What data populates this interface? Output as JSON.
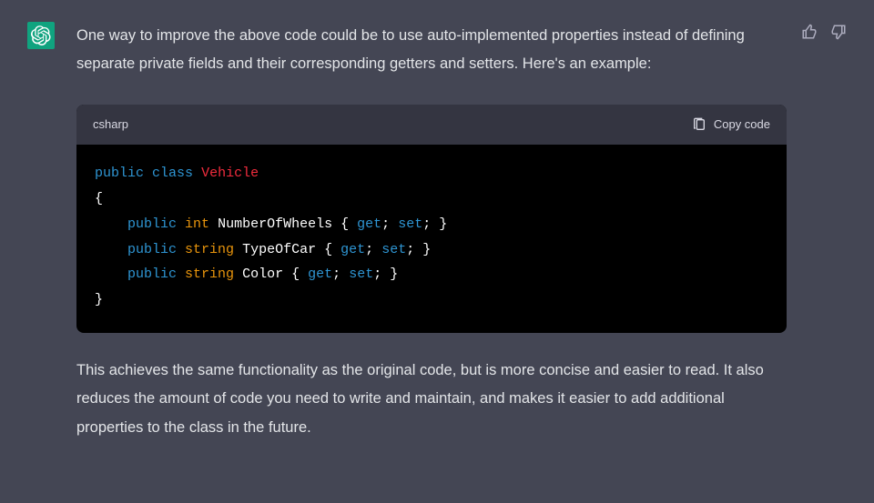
{
  "avatar": {
    "bg": "#10a37f"
  },
  "message": {
    "intro": "One way to improve the above code could be to use auto-implemented properties instead of defining separate private fields and their corresponding getters and setters. Here's an example:",
    "outro": "This achieves the same functionality as the original code, but is more concise and easier to read. It also reduces the amount of code you need to write and maintain, and makes it easier to add additional properties to the class in the future."
  },
  "codeblock": {
    "language": "csharp",
    "copy_label": "Copy code",
    "tokens": [
      [
        [
          "kw",
          "public"
        ],
        [
          "sp",
          " "
        ],
        [
          "kw",
          "class"
        ],
        [
          "sp",
          " "
        ],
        [
          "cls",
          "Vehicle"
        ]
      ],
      [
        [
          "punc",
          "{"
        ]
      ],
      [
        [
          "sp",
          "    "
        ],
        [
          "kw",
          "public"
        ],
        [
          "sp",
          " "
        ],
        [
          "type",
          "int"
        ],
        [
          "sp",
          " "
        ],
        [
          "id",
          "NumberOfWheels"
        ],
        [
          "sp",
          " "
        ],
        [
          "punc",
          "{"
        ],
        [
          "sp",
          " "
        ],
        [
          "kw",
          "get"
        ],
        [
          "punc",
          ";"
        ],
        [
          "sp",
          " "
        ],
        [
          "kw",
          "set"
        ],
        [
          "punc",
          ";"
        ],
        [
          "sp",
          " "
        ],
        [
          "punc",
          "}"
        ]
      ],
      [
        [
          "sp",
          "    "
        ],
        [
          "kw",
          "public"
        ],
        [
          "sp",
          " "
        ],
        [
          "type",
          "string"
        ],
        [
          "sp",
          " "
        ],
        [
          "id",
          "TypeOfCar"
        ],
        [
          "sp",
          " "
        ],
        [
          "punc",
          "{"
        ],
        [
          "sp",
          " "
        ],
        [
          "kw",
          "get"
        ],
        [
          "punc",
          ";"
        ],
        [
          "sp",
          " "
        ],
        [
          "kw",
          "set"
        ],
        [
          "punc",
          ";"
        ],
        [
          "sp",
          " "
        ],
        [
          "punc",
          "}"
        ]
      ],
      [
        [
          "sp",
          "    "
        ],
        [
          "kw",
          "public"
        ],
        [
          "sp",
          " "
        ],
        [
          "type",
          "string"
        ],
        [
          "sp",
          " "
        ],
        [
          "id",
          "Color"
        ],
        [
          "sp",
          " "
        ],
        [
          "punc",
          "{"
        ],
        [
          "sp",
          " "
        ],
        [
          "kw",
          "get"
        ],
        [
          "punc",
          ";"
        ],
        [
          "sp",
          " "
        ],
        [
          "kw",
          "set"
        ],
        [
          "punc",
          ";"
        ],
        [
          "sp",
          " "
        ],
        [
          "punc",
          "}"
        ]
      ],
      [
        [
          "punc",
          "}"
        ]
      ]
    ]
  },
  "feedback": {
    "up_icon": "thumbs-up",
    "down_icon": "thumbs-down"
  }
}
